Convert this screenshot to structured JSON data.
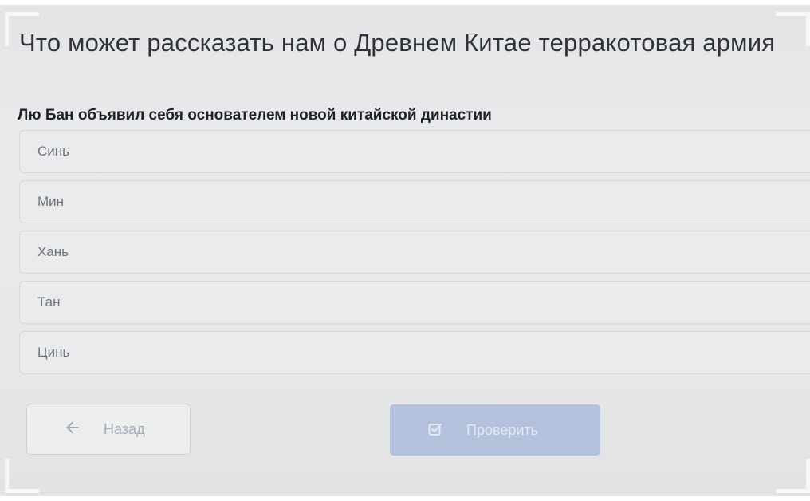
{
  "quiz": {
    "title": "Что может рассказать нам о Древнем Китае терракотовая армия",
    "question": "Лю Бан объявил себя основателем новой китайской династии",
    "options": [
      {
        "label": "Синь"
      },
      {
        "label": "Мин"
      },
      {
        "label": "Хань"
      },
      {
        "label": "Тан"
      },
      {
        "label": "Цинь"
      }
    ]
  },
  "buttons": {
    "back": {
      "label": "Назад",
      "icon": "arrow-left-icon"
    },
    "check": {
      "label": "Проверить",
      "icon": "checkbox-icon"
    }
  },
  "colors": {
    "check_button_bg": "#b4c1dc",
    "back_button_text": "#a6adb8"
  }
}
